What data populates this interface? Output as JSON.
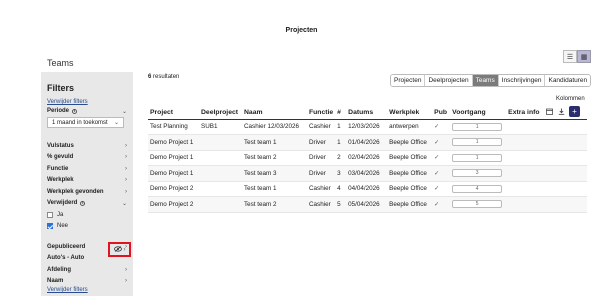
{
  "page": {
    "title": "Projecten",
    "section_title": "Teams"
  },
  "view_toggle": {
    "list_icon": "list-icon",
    "grid_icon": "grid-icon"
  },
  "filters": {
    "heading": "Filters",
    "reset_top": "Verwijder filters",
    "reset_bottom": "Verwijder filters",
    "period": {
      "label": "Periode",
      "selected": "1 maand in toekomst"
    },
    "items_a": [
      {
        "label": "Vulstatus"
      },
      {
        "label": "% gevuld"
      },
      {
        "label": "Functie"
      },
      {
        "label": "Werkplek"
      },
      {
        "label": "Werkplek gevonden"
      }
    ],
    "verwijderd": {
      "label": "Verwijderd",
      "options": [
        {
          "label": "Ja",
          "checked": false
        },
        {
          "label": "Nee",
          "checked": true
        }
      ]
    },
    "items_b": [
      {
        "label": "Gepubliceerd"
      },
      {
        "label": "Auto's - Auto"
      },
      {
        "label": "Afdeling"
      },
      {
        "label": "Naam"
      }
    ]
  },
  "results": {
    "count": "6",
    "suffix": "resultaten"
  },
  "tabs": [
    {
      "label": "Projecten",
      "active": false
    },
    {
      "label": "Deelprojecten",
      "active": false
    },
    {
      "label": "Teams",
      "active": true
    },
    {
      "label": "Inschrijvingen",
      "active": false
    },
    {
      "label": "Kandidaturen",
      "active": false
    }
  ],
  "columns_label": "Kolommen",
  "table": {
    "headers": [
      "Project",
      "Deelproject",
      "Naam",
      "Functie",
      "#",
      "Datums",
      "Werkplek",
      "Pub",
      "Voortgang",
      "Extra info"
    ],
    "rows": [
      {
        "project": "Test Planning",
        "deelproject": "SUB1",
        "naam": "Cashier 12/03/2026",
        "functie": "Cashier",
        "nr": "1",
        "datum": "12/03/2026",
        "werkplek": "antwerpen",
        "pub": "✓",
        "voortgang": "1"
      },
      {
        "project": "Demo Project 1",
        "deelproject": "",
        "naam": "Test team 1",
        "functie": "Driver",
        "nr": "1",
        "datum": "01/04/2026",
        "werkplek": "Beeple Office",
        "pub": "✓",
        "voortgang": "1"
      },
      {
        "project": "Demo Project 1",
        "deelproject": "",
        "naam": "Test team 2",
        "functie": "Driver",
        "nr": "2",
        "datum": "02/04/2026",
        "werkplek": "Beeple Office",
        "pub": "✓",
        "voortgang": "1"
      },
      {
        "project": "Demo Project 1",
        "deelproject": "",
        "naam": "Test team 3",
        "functie": "Driver",
        "nr": "3",
        "datum": "03/04/2026",
        "werkplek": "Beeple Office",
        "pub": "✓",
        "voortgang": "3"
      },
      {
        "project": "Demo Project 2",
        "deelproject": "",
        "naam": "Test team 1",
        "functie": "Cashier",
        "nr": "4",
        "datum": "04/04/2026",
        "werkplek": "Beeple Office",
        "pub": "✓",
        "voortgang": "4"
      },
      {
        "project": "Demo Project 2",
        "deelproject": "",
        "naam": "Test team 2",
        "functie": "Cashier",
        "nr": "5",
        "datum": "05/04/2026",
        "werkplek": "Beeple Office",
        "pub": "✓",
        "voortgang": "5"
      }
    ]
  },
  "colors": {
    "accent": "#2b2d6e",
    "highlight": "#e0141e",
    "link": "#2a4d8f",
    "tab_active": "#7b7b7b",
    "sidebar_bg": "#e8e8e8"
  }
}
